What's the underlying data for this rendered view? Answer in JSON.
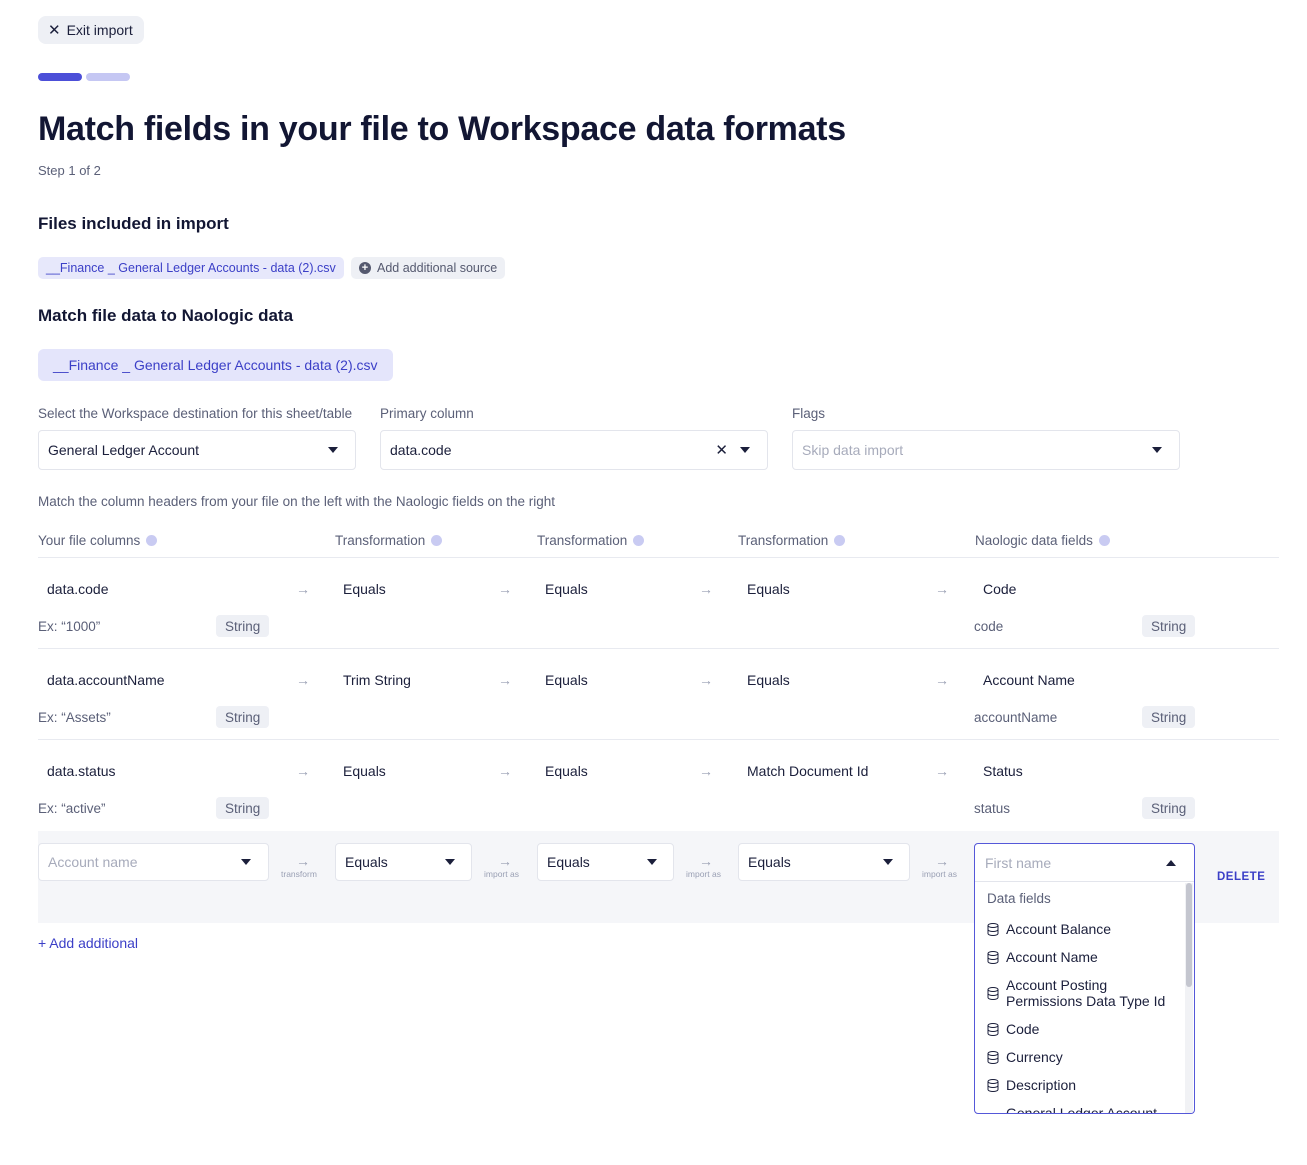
{
  "header": {
    "exit_label": "Exit import",
    "title": "Match fields in your file to Workspace data formats",
    "step": "Step 1 of 2",
    "progress": {
      "current": 1,
      "total": 2,
      "active_color": "#4c4fd8",
      "inactive_color": "#c5c7f3"
    }
  },
  "files": {
    "heading": "Files included in import",
    "file_chip": "__Finance _ General Ledger Accounts - data (2).csv",
    "add_source": "Add additional source"
  },
  "match": {
    "heading": "Match file data to Naologic data",
    "active_file_tab": "__Finance _ General Ledger Accounts - data (2).csv",
    "destination": {
      "label": "Select the Workspace destination for this sheet/table",
      "value": "General Ledger Account"
    },
    "primary": {
      "label": "Primary column",
      "value": "data.code"
    },
    "flags": {
      "label": "Flags",
      "placeholder": "Skip data import"
    },
    "hint": "Match the column headers from your file on the left with the Naologic fields on the right"
  },
  "columns": {
    "file": "Your file columns",
    "t1": "Transformation",
    "t2": "Transformation",
    "t3": "Transformation",
    "fields": "Naologic data fields"
  },
  "rows": [
    {
      "file_col": "data.code",
      "example": "Ex: “1000”",
      "type": "String",
      "t1": "Equals",
      "t2": "Equals",
      "t3": "Equals",
      "field": "Code",
      "field_key": "code",
      "field_type": "String"
    },
    {
      "file_col": "data.accountName",
      "example": "Ex: “Assets”",
      "type": "String",
      "t1": "Trim String",
      "t2": "Equals",
      "t3": "Equals",
      "field": "Account Name",
      "field_key": "accountName",
      "field_type": "String"
    },
    {
      "file_col": "data.status",
      "example": "Ex: “active”",
      "type": "String",
      "t1": "Equals",
      "t2": "Equals",
      "t3": "Match Document Id",
      "field": "Status",
      "field_key": "status",
      "field_type": "String"
    }
  ],
  "new_row": {
    "file_placeholder": "Account name",
    "arrow_labels": [
      "transform",
      "import as",
      "import as",
      "import as"
    ],
    "t1": "Equals",
    "t2": "Equals",
    "t3": "Equals",
    "field_placeholder": "First name",
    "delete_label": "DELETE"
  },
  "add_additional": "+ Add additional",
  "dropdown": {
    "group": "Data fields",
    "items": [
      "Account Balance",
      "Account Name",
      "Account Posting Permissions Data Type Id",
      "Code",
      "Currency",
      "Description",
      "General Ledger Account"
    ]
  },
  "icons": {
    "close": "close-icon",
    "plus": "plus-circle-icon",
    "caret": "caret-down-icon",
    "arrow": "arrow-right-icon",
    "info": "info-icon",
    "database": "database-icon"
  }
}
